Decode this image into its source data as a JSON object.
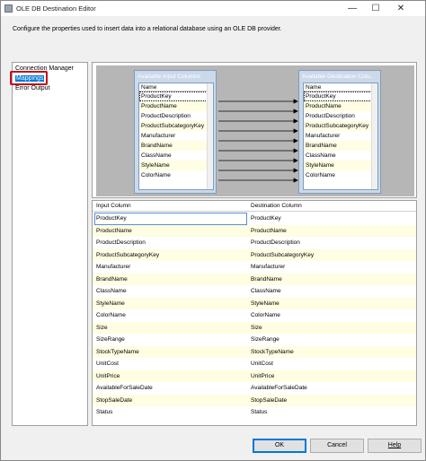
{
  "window": {
    "title": "OLE DB Destination Editor",
    "minimize_glyph": "—",
    "maximize_glyph": "☐",
    "close_glyph": "✕"
  },
  "description": "Configure the properties used to insert data into a relational database using an OLE DB provider.",
  "nav": {
    "items": [
      {
        "label": "Connection Manager",
        "selected": false
      },
      {
        "label": "Mappings",
        "selected": true
      },
      {
        "label": "Error Output",
        "selected": false
      }
    ]
  },
  "input_box": {
    "title": "Available Input Columns",
    "header": "Name",
    "rows": [
      "ProductKey",
      "ProductName",
      "ProductDescription",
      "ProductSubcategoryKey",
      "Manufacturer",
      "BrandName",
      "ClassName",
      "StyleName",
      "ColorName"
    ]
  },
  "dest_box": {
    "title": "Available Destination Colu...",
    "header": "Name",
    "rows": [
      "ProductKey",
      "ProductName",
      "ProductDescription",
      "ProductSubcategoryKey",
      "Manufacturer",
      "BrandName",
      "ClassName",
      "StyleName",
      "ColorName"
    ]
  },
  "grid": {
    "headers": [
      "Input Column",
      "Destination Column"
    ],
    "rows": [
      [
        "ProductKey",
        "ProductKey"
      ],
      [
        "ProductName",
        "ProductName"
      ],
      [
        "ProductDescription",
        "ProductDescription"
      ],
      [
        "ProductSubcategoryKey",
        "ProductSubcategoryKey"
      ],
      [
        "Manufacturer",
        "Manufacturer"
      ],
      [
        "BrandName",
        "BrandName"
      ],
      [
        "ClassName",
        "ClassName"
      ],
      [
        "StyleName",
        "StyleName"
      ],
      [
        "ColorName",
        "ColorName"
      ],
      [
        "Size",
        "Size"
      ],
      [
        "SizeRange",
        "SizeRange"
      ],
      [
        "StockTypeName",
        "StockTypeName"
      ],
      [
        "UnitCost",
        "UnitCost"
      ],
      [
        "UnitPrice",
        "UnitPrice"
      ],
      [
        "AvailableForSaleDate",
        "AvailableForSaleDate"
      ],
      [
        "StopSaleDate",
        "StopSaleDate"
      ],
      [
        "Status",
        "Status"
      ]
    ]
  },
  "buttons": {
    "ok": "OK",
    "cancel": "Cancel",
    "help": "Help"
  },
  "colors": {
    "selection": "#0078d7",
    "highlight_box": "#c0121a",
    "alt_row": "#fffde2"
  }
}
